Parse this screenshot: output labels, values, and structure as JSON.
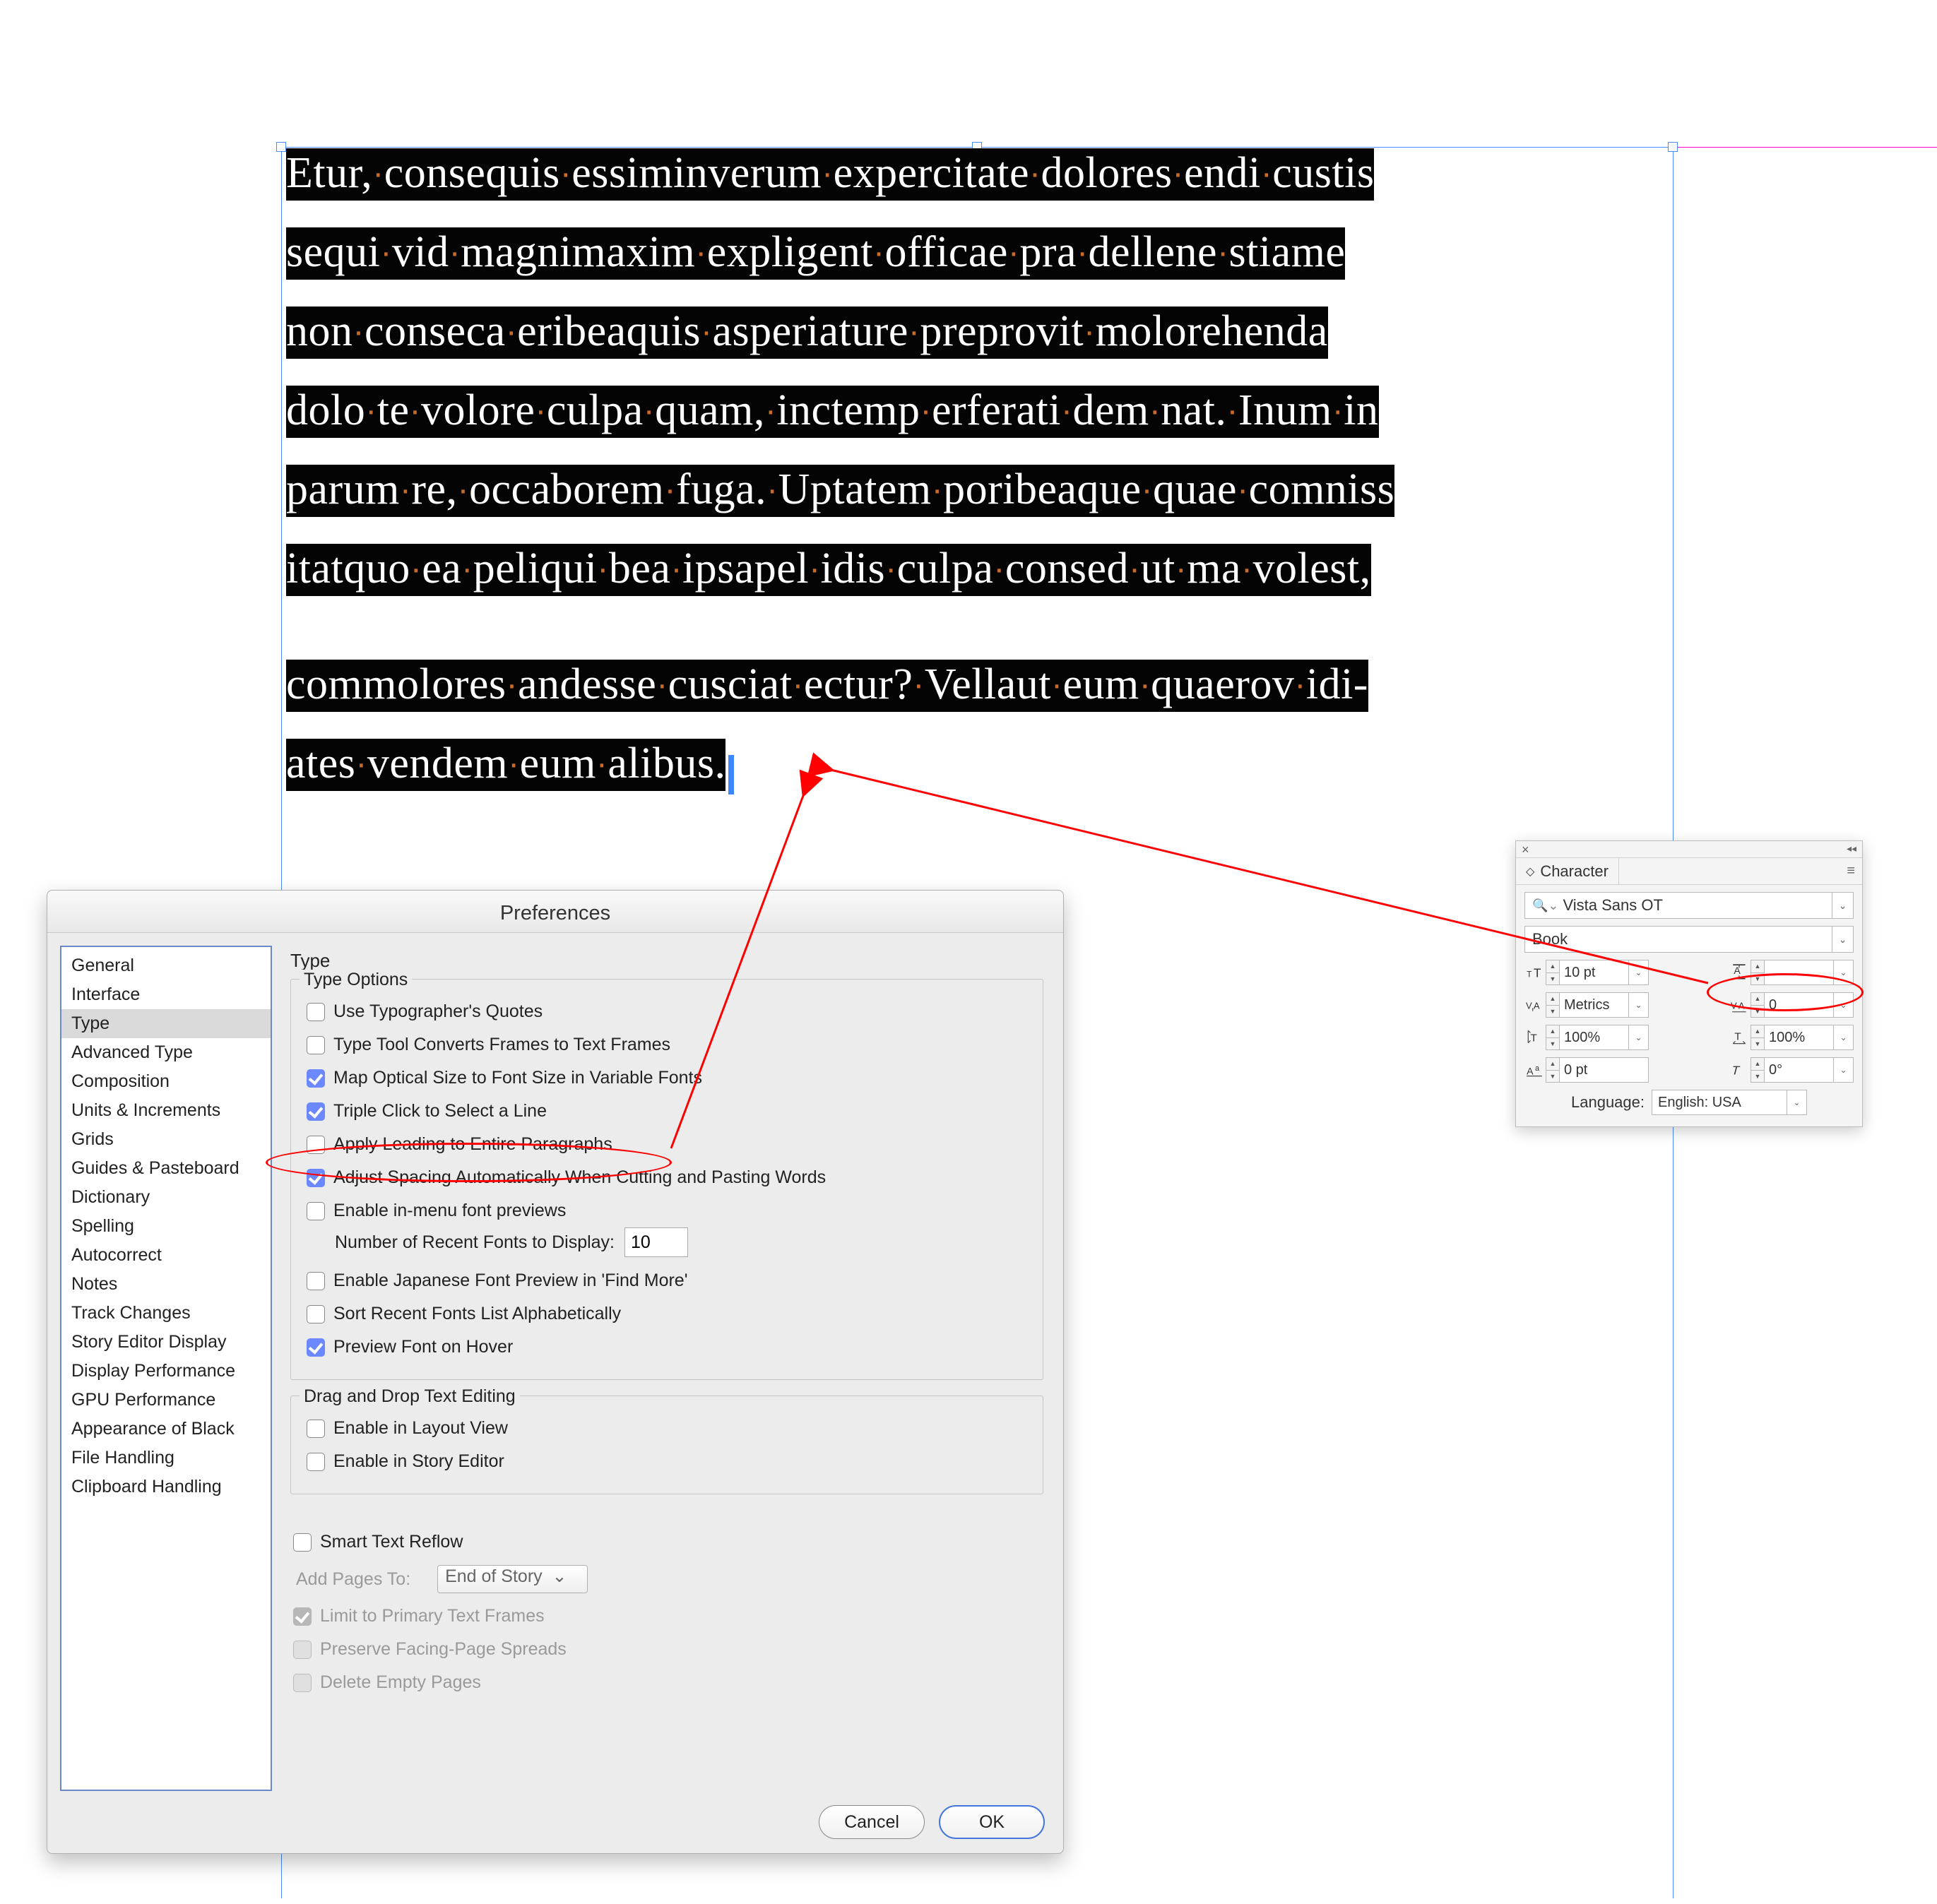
{
  "document": {
    "lines_para1": [
      [
        "Etur,",
        "consequis",
        "essiminverum",
        "expercitate",
        "dolores",
        "endi",
        "custis"
      ],
      [
        "sequi",
        "vid",
        "magnimaxim",
        "expligent",
        "officae",
        "pra",
        "dellene",
        "stiame"
      ],
      [
        "non",
        "conseca",
        "eribeaquis",
        "asperiature",
        "preprovit",
        "molorehenda"
      ],
      [
        "dolo",
        "te",
        "volore",
        "culpa",
        "quam,",
        "inctemp",
        "erferati",
        "dem",
        "nat.",
        "Inum",
        "in"
      ],
      [
        "parum",
        "re,",
        "occaborem",
        "fuga.",
        "Uptatem",
        "poribeaque",
        "quae",
        "comniss"
      ],
      [
        "itatquo",
        "ea",
        "peliqui",
        "bea",
        "ipsapel",
        "idis",
        "culpa",
        "consed",
        "ut",
        "ma",
        "volest,"
      ]
    ],
    "lines_para2": [
      [
        "commolores",
        "andesse",
        "cusciat",
        "ectur?",
        "Vellaut",
        "eum",
        "quaerov",
        "idi-"
      ],
      [
        "ates",
        "vendem",
        "eum",
        "alibus."
      ]
    ]
  },
  "prefs": {
    "title": "Preferences",
    "sidebar": [
      "General",
      "Interface",
      "Type",
      "Advanced Type",
      "Composition",
      "Units & Increments",
      "Grids",
      "Guides & Pasteboard",
      "Dictionary",
      "Spelling",
      "Autocorrect",
      "Notes",
      "Track Changes",
      "Story Editor Display",
      "Display Performance",
      "GPU Performance",
      "Appearance of Black",
      "File Handling",
      "Clipboard Handling"
    ],
    "sidebar_selected": 2,
    "main_title": "Type",
    "type_options_legend": "Type Options",
    "opts": {
      "typographers_quotes": "Use Typographer's Quotes",
      "convert_frames": "Type Tool Converts Frames to Text Frames",
      "map_optical": "Map Optical Size to Font Size in Variable Fonts",
      "triple_click": "Triple Click to Select a Line",
      "apply_leading": "Apply Leading to Entire Paragraphs",
      "adjust_spacing": "Adjust Spacing Automatically When Cutting and Pasting Words",
      "inmenu_preview": "Enable in-menu font previews",
      "recent_fonts_label": "Number of Recent Fonts to Display:",
      "recent_fonts_value": "10",
      "japanese_preview": "Enable Japanese Font Preview in 'Find More'",
      "sort_recent": "Sort Recent Fonts List Alphabetically",
      "preview_hover": "Preview Font on Hover"
    },
    "dnd_legend": "Drag and Drop Text Editing",
    "dnd": {
      "layout_view": "Enable in Layout View",
      "story_editor": "Enable in Story Editor"
    },
    "reflow": {
      "smart": "Smart Text Reflow",
      "add_pages_label": "Add Pages To:",
      "add_pages_value": "End of Story",
      "limit": "Limit to Primary Text Frames",
      "preserve": "Preserve Facing-Page Spreads",
      "delete": "Delete Empty Pages"
    },
    "cancel": "Cancel",
    "ok": "OK"
  },
  "char": {
    "panel_title": "Character",
    "font_family": "Vista Sans OT",
    "font_style": "Book",
    "font_size": "10 pt",
    "leading": "",
    "kerning": "Metrics",
    "tracking": "0",
    "vscale": "100%",
    "hscale": "100%",
    "baseline": "0 pt",
    "skew": "0°",
    "lang_label": "Language:",
    "lang_value": "English: USA"
  }
}
